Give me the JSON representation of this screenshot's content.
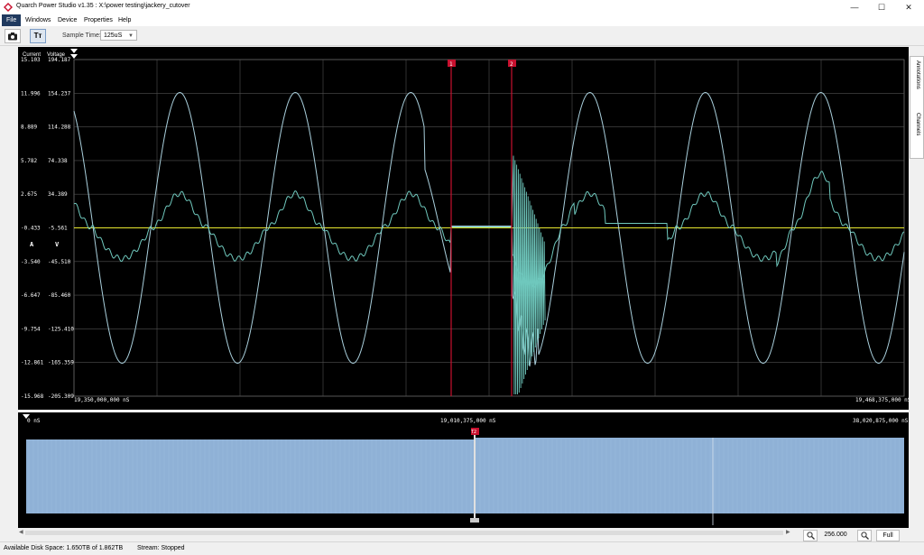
{
  "window": {
    "title": "Quarch Power Studio v1.35 : X:\\power testing\\jackery_cutover",
    "minimize": "—",
    "maximize": "☐",
    "close": "✕"
  },
  "menu": [
    "File",
    "Windows",
    "Device",
    "Properties",
    "Help"
  ],
  "toolbar": {
    "camera_icon": "camera-icon",
    "text_icon": "text-tool-icon",
    "text_button_label": "Tт",
    "sample_time_label": "Sample Time:",
    "sample_time_value": "125uS"
  },
  "side_tabs": {
    "annotations": "Annotations",
    "channels": "Channels"
  },
  "main_chart": {
    "current_header": "Current",
    "voltage_header": "Voltage",
    "current_ticks": [
      "15.103",
      "11.996",
      "8.889",
      "5.782",
      "2.675",
      "-0.433",
      "-3.540",
      "-6.647",
      "-9.754",
      "-12.861",
      "-15.968"
    ],
    "voltage_ticks": [
      "194.187",
      "154.237",
      "114.288",
      "74.338",
      "34.389",
      "-5.561",
      "-45.510",
      "-85.460",
      "-125.410",
      "-165.359",
      "-205.309"
    ],
    "current_unit": "A",
    "voltage_unit": "V",
    "time_start": "19,350,000,000 nS",
    "time_end": "19,468,375,000 nS",
    "marker_labels": [
      "1",
      "2"
    ],
    "colors": {
      "background": "#000000",
      "current_trace": "#6fc8bd",
      "voltage_trace": "#a9cfdc",
      "zero_line": "#e8e830",
      "cursor": "#c8102e",
      "grid": "#505050"
    }
  },
  "overview_chart": {
    "time_start": "0 nS",
    "time_mid": "19,010,375,000 nS",
    "time_end": "38,020,875,000 nS",
    "marker_label": "T2",
    "fill_color": "#8fb1d6"
  },
  "zoom": {
    "value": "256.000",
    "full_label": "Full",
    "zoom_in_icon": "zoom-in-icon",
    "zoom_out_icon": "zoom-out-icon"
  },
  "status": {
    "disk_space": "Available Disk Space: 1.650TB of 1.862TB",
    "stream": "Stream:  Stopped"
  }
}
